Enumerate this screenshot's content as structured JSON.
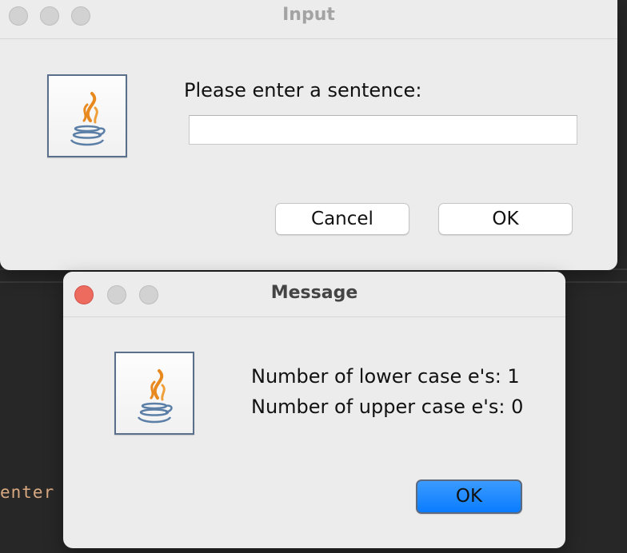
{
  "background": {
    "code_fragment": "enter"
  },
  "input_dialog": {
    "title": "Input",
    "prompt": "Please enter a sentence:",
    "field_value": "",
    "cancel_label": "Cancel",
    "ok_label": "OK",
    "icon": "java-cup-icon"
  },
  "message_dialog": {
    "title": "Message",
    "line1": "Number of lower case e's: 1",
    "line2": "Number of upper case e's: 0",
    "ok_label": "OK",
    "icon": "java-cup-icon"
  },
  "colors": {
    "close_button": "#ed6a5e",
    "default_button": "#0a7cff",
    "dialog_bg": "#ececec"
  }
}
